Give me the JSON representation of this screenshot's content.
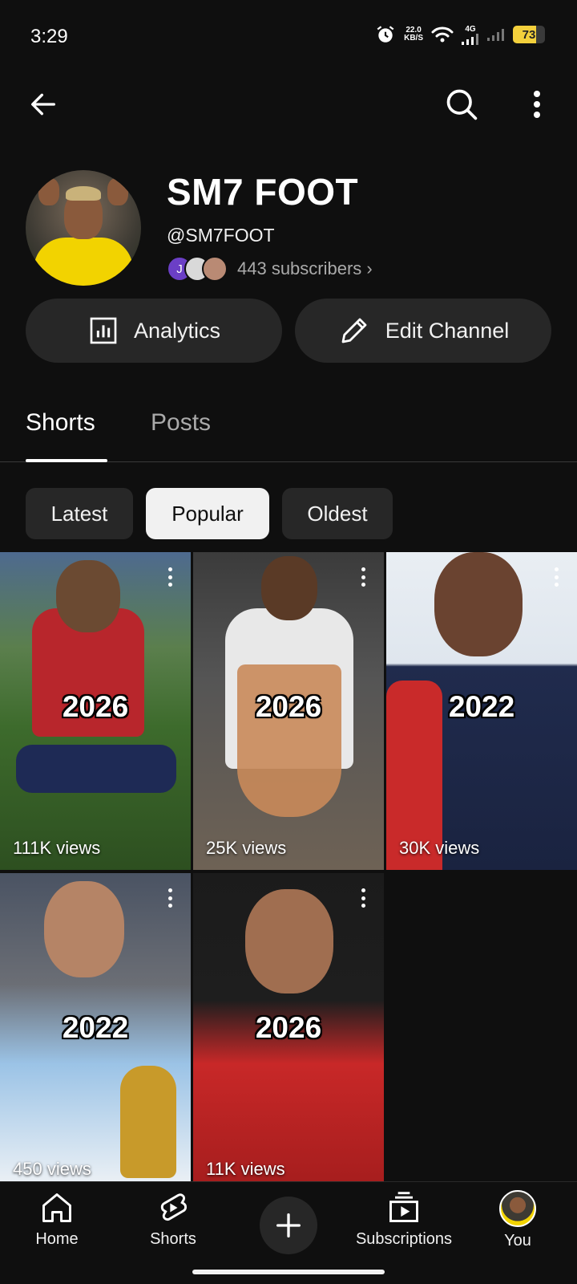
{
  "status_bar": {
    "time": "3:29",
    "net_speed_top": "22.0",
    "net_speed_bottom": "KB/S",
    "network": "4G",
    "battery": "73"
  },
  "channel": {
    "name": "SM7 FOOT",
    "handle": "@SM7FOOT",
    "subscriber_initial": "J",
    "subscribers": "443 subscribers",
    "subscribers_chevron": "›"
  },
  "actions": {
    "analytics": "Analytics",
    "edit_channel": "Edit Channel"
  },
  "tabs": [
    {
      "label": "Shorts",
      "selected": true
    },
    {
      "label": "Posts",
      "selected": false
    }
  ],
  "chips": [
    {
      "label": "Latest",
      "selected": false
    },
    {
      "label": "Popular",
      "selected": true
    },
    {
      "label": "Oldest",
      "selected": false
    }
  ],
  "shorts": [
    {
      "year": "2026",
      "views": "111K views"
    },
    {
      "year": "2026",
      "views": "25K views"
    },
    {
      "year": "2022",
      "views": "30K views"
    },
    {
      "year": "2022",
      "views": "450 views"
    },
    {
      "year": "2026",
      "views": "11K views"
    }
  ],
  "bottom_nav": {
    "home": "Home",
    "shorts": "Shorts",
    "subscriptions": "Subscriptions",
    "you": "You"
  },
  "colors": {
    "background": "#0f0f0f",
    "surface": "#272727",
    "text_secondary": "#aaaaaa",
    "chip_selected": "#f1f1f1"
  }
}
